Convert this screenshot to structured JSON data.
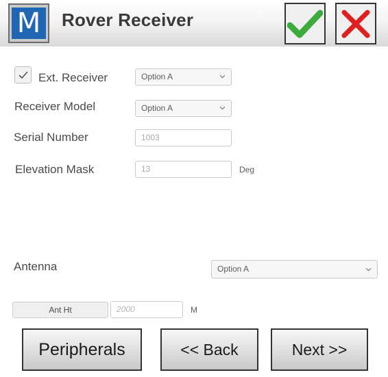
{
  "header": {
    "logo_letter": "M",
    "title": "Rover Receiver",
    "ok_icon": "checkmark-icon",
    "cancel_icon": "x-icon",
    "colors": {
      "logo_bg": "#1f66b5",
      "ok": "#3caa3c",
      "cancel": "#e02020"
    }
  },
  "form": {
    "ext_receiver": {
      "label": "Ext. Receiver",
      "checked": true,
      "value": "Option A"
    },
    "receiver_model": {
      "label": "Receiver Model",
      "value": "Option A"
    },
    "serial_number": {
      "label": "Serial Number",
      "placeholder": "1003"
    },
    "elevation_mask": {
      "label": "Elevation Mask",
      "placeholder": "13",
      "unit": "Deg"
    },
    "antenna": {
      "label": "Antenna",
      "value": "Option A"
    },
    "ant_ht": {
      "button_label": "Ant Ht",
      "placeholder": "2000",
      "unit": "M"
    }
  },
  "footer": {
    "peripherals": "Peripherals",
    "back": "<< Back",
    "next": "Next >>"
  }
}
